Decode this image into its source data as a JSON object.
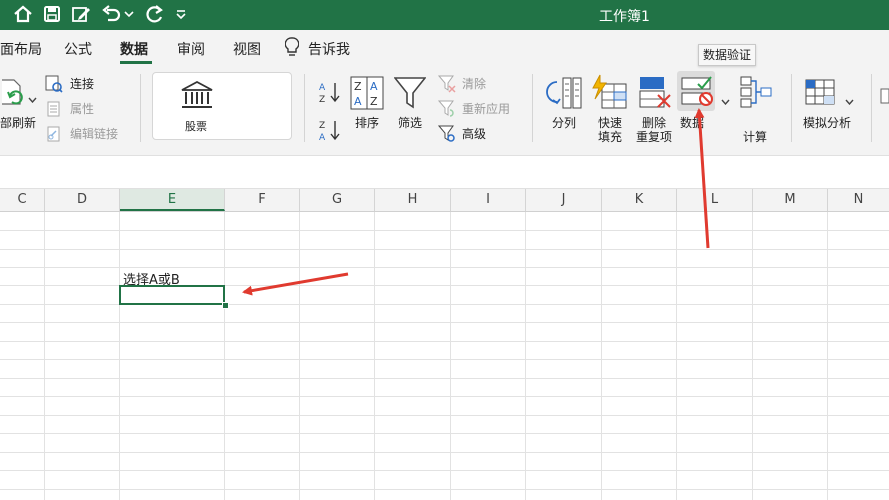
{
  "title_bar": {
    "document_title": "工作簿1",
    "quick_access_icons": [
      "home-icon",
      "save-icon",
      "edit-icon",
      "undo-icon",
      "chevron-down-icon",
      "redo-icon",
      "customize-icon"
    ]
  },
  "menu_tabs": [
    {
      "label": "页面布局",
      "visible_label": "面布局"
    },
    {
      "label": "公式"
    },
    {
      "label": "数据",
      "active": true
    },
    {
      "label": "审阅"
    },
    {
      "label": "视图"
    },
    {
      "label": "告诉我"
    }
  ],
  "ribbon": {
    "refresh_all": "部刷新",
    "connections": "连接",
    "properties": "属性",
    "edit_links": "编辑链接",
    "stocks": "股票",
    "sort": "排序",
    "filter": "筛选",
    "clear": "清除",
    "reapply": "重新应用",
    "advanced": "高级",
    "text_to_columns": "分列",
    "flash_fill_1": "快速",
    "flash_fill_2": "填充",
    "remove_dup_1": "删除",
    "remove_dup_2": "重复项",
    "data_validation": "数据",
    "data_validation_tooltip": "数据验证",
    "consolidate": "计算",
    "what_if": "模拟分析"
  },
  "columns": [
    "C",
    "D",
    "E",
    "F",
    "G",
    "H",
    "I",
    "J",
    "K",
    "L",
    "M",
    "N"
  ],
  "selected_column": "E",
  "cells": {
    "E_note": "选择A或B"
  },
  "colors": {
    "accent": "#217346",
    "annotation_arrow": "#e03a2f"
  }
}
